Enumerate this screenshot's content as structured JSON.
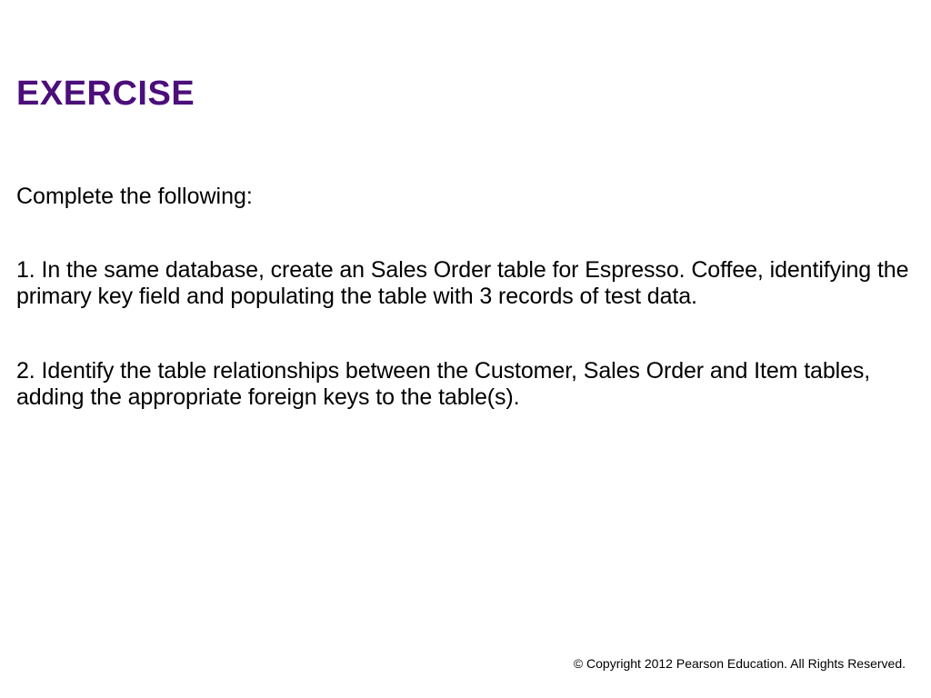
{
  "slide": {
    "title": "EXERCISE",
    "intro": "Complete the following:",
    "items": [
      "1. In the same database, create an Sales Order table for Espresso. Coffee, identifying the primary key field and populating the table with 3 records of test data.",
      "2. Identify the table relationships between the Customer, Sales Order and Item tables, adding the appropriate foreign keys to the table(s)."
    ],
    "footer": "© Copyright 2012 Pearson Education. All Rights Reserved."
  }
}
